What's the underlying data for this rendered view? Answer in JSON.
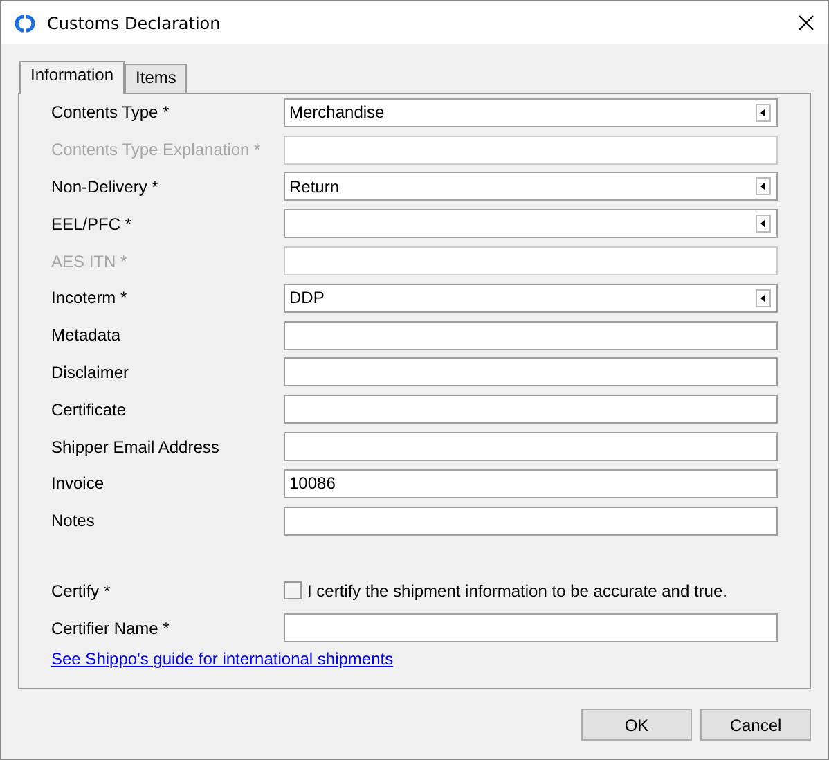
{
  "window": {
    "title": "Customs Declaration"
  },
  "tabs": [
    {
      "label": "Information",
      "selected": true
    },
    {
      "label": "Items",
      "selected": false
    }
  ],
  "fields": [
    {
      "label": "Contents Type *",
      "kind": "dropdown",
      "value": "Merchandise",
      "disabled": false
    },
    {
      "label": "Contents Type Explanation *",
      "kind": "text",
      "disabled": true
    },
    {
      "label": "Non-Delivery *",
      "kind": "dropdown",
      "value": "Return",
      "disabled": false
    },
    {
      "label": "EEL/PFC *",
      "kind": "dropdown",
      "disabled": false
    },
    {
      "label": "AES ITN *",
      "kind": "text",
      "disabled": true
    },
    {
      "label": "Incoterm *",
      "kind": "dropdown",
      "value": "DDP",
      "disabled": false
    },
    {
      "label": "Metadata",
      "kind": "text",
      "disabled": false
    },
    {
      "label": "Disclaimer",
      "kind": "text",
      "disabled": false
    },
    {
      "label": "Certificate",
      "kind": "text",
      "disabled": false
    },
    {
      "label": "Shipper Email Address",
      "kind": "text",
      "disabled": false
    },
    {
      "label": "Invoice",
      "kind": "text",
      "value": "10086",
      "disabled": false
    },
    {
      "label": "Notes",
      "kind": "text",
      "disabled": false
    }
  ],
  "certify": {
    "label": "Certify *",
    "checkbox_label": "I certify the shipment information to be accurate and true.",
    "checked": false
  },
  "certifier": {
    "label": "Certifier Name *"
  },
  "link": "See Shippo's guide for international shipments",
  "buttons": [
    "OK",
    "Cancel"
  ]
}
